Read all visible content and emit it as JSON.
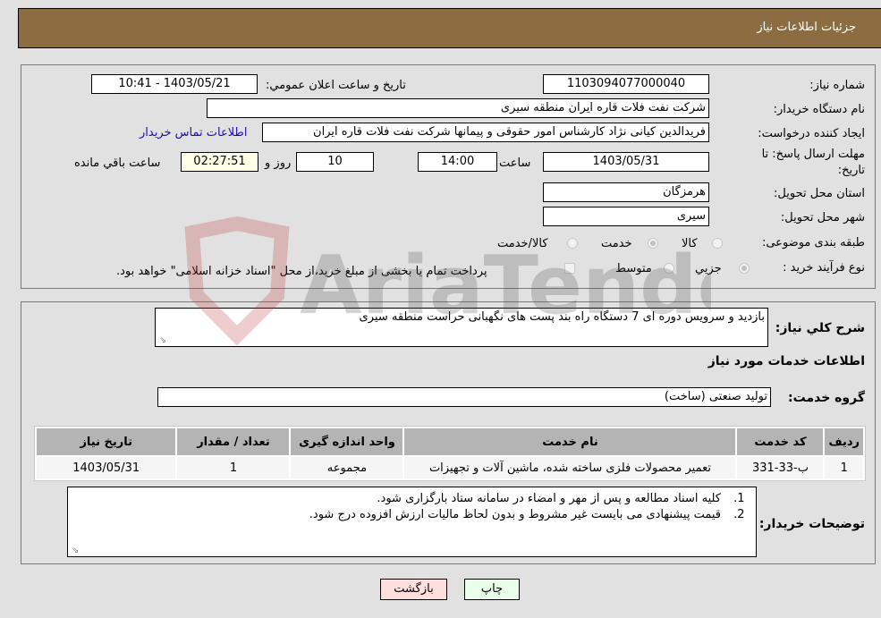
{
  "header": {
    "title": "جزئیات اطلاعات نیاز"
  },
  "details": {
    "need_number_label": "شماره نیاز:",
    "need_number": "1103094077000040",
    "announce_label": "تاریخ و ساعت اعلان عمومي:",
    "announce_value": "1403/05/21 - 10:41",
    "buyer_org_label": "نام دستگاه خریدار:",
    "buyer_org": "شرکت نفت فلات قاره ایران منطقه سیری",
    "requester_label": "ایجاد کننده درخواست:",
    "requester": "فریدالدین کیانی نژاد کارشناس امور حقوقی و پیمانها شرکت نفت فلات قاره ایران",
    "buyer_contact_link": "اطلاعات تماس خریدار",
    "deadline_label_line1": "مهلت ارسال پاسخ: تا",
    "deadline_label_line2": "تاریخ:",
    "deadline_date": "1403/05/31",
    "time_label": "ساعت",
    "deadline_time": "14:00",
    "days_value": "10",
    "days_label": "روز و",
    "remaining_time": "02:27:51",
    "remaining_label": "ساعت باقي مانده",
    "province_label": "استان محل تحویل:",
    "province": "هرمزگان",
    "city_label": "شهر محل تحویل:",
    "city": "سیری",
    "category_label": "طبقه بندی موضوعی:",
    "category_options": [
      {
        "label": "کالا",
        "checked": false
      },
      {
        "label": "خدمت",
        "checked": true
      },
      {
        "label": "کالا/خدمت",
        "checked": false
      }
    ],
    "process_label": "نوع فرآیند خرید :",
    "process_options": [
      {
        "label": "جزيي",
        "checked": true
      },
      {
        "label": "متوسط",
        "checked": false
      }
    ],
    "treasury_note": "پرداخت تمام یا بخشی از مبلغ خرید،از محل \"اسناد خزانه اسلامی\" خواهد بود."
  },
  "description": {
    "label": "شرح کلي نياز:",
    "value": "بازدید و سرویس دوره ای 7 دستگاه راه بند پست های نگهبانی حراست منطقه سیری"
  },
  "services": {
    "section_title": "اطلاعات خدمات مورد نیاز",
    "group_label": "گروه خدمت:",
    "group_value": "تولید صنعتی (ساخت)",
    "table": {
      "headers": [
        "ردیف",
        "کد خدمت",
        "نام خدمت",
        "واحد اندازه گیری",
        "تعداد / مقدار",
        "تاریخ نیاز"
      ],
      "rows": [
        [
          "1",
          "ب-33-331",
          "تعمیر محصولات فلزی ساخته شده، ماشین آلات و تجهیزات",
          "مجموعه",
          "1",
          "1403/05/31"
        ]
      ]
    }
  },
  "buyer_notes": {
    "label": "توضیحات خریدار:",
    "items": [
      "کلیه اسناد مطالعه و پس از مهر و امضاء در سامانه ستاد بارگزاری شود.",
      "قیمت پیشنهادی می بایست غیر مشروط و بدون لحاظ مالیات ارزش افزوده درج شود."
    ]
  },
  "buttons": {
    "print": "چاپ",
    "back": "بازگشت"
  },
  "watermark": {
    "text": "AriaTender.neT"
  },
  "colors": {
    "header_bg": "#8c6d42",
    "link": "#1a0dab",
    "back_btn": "#ffdede",
    "print_btn": "#eaffea"
  }
}
